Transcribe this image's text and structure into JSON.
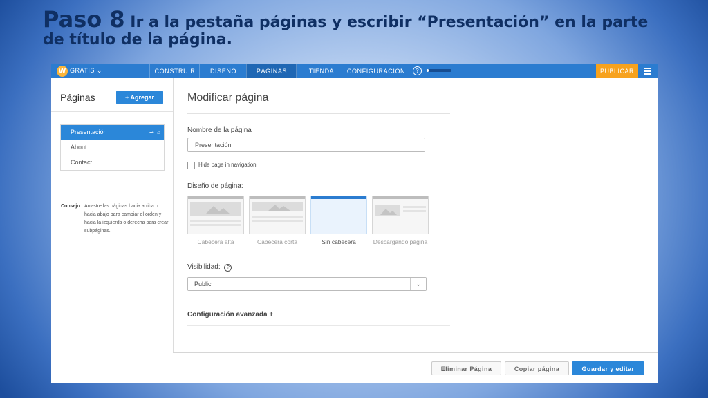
{
  "slide": {
    "title_step": "Paso 8",
    "title_text": " Ir a la pestaña páginas y escribir “Presentación” en la parte de título de la página."
  },
  "topbar": {
    "logo": "W",
    "plan": "GRATIS ⌄",
    "nav": [
      "CONSTRUIR",
      "DISEÑO",
      "PÁGINAS",
      "TIENDA",
      "CONFIGURACIÓN"
    ],
    "active_tab": "PÁGINAS",
    "help": "?",
    "progress_fraction": 0.08,
    "publish": "PUBLICAR",
    "colors": {
      "bar": "#2b7cd0",
      "publish": "#f7a21e"
    }
  },
  "sidebar": {
    "title": "Páginas",
    "add_button": "+  Agregar",
    "pages": [
      "Presentación",
      "About",
      "Contact"
    ],
    "selected_page": "Presentación",
    "tip_label": "Consejo:",
    "tip_text": "Arrastre las páginas hacia arriba o hacia abajo para cambiar el orden y hacia la izquierda o derecha para crear subpáginas."
  },
  "editor": {
    "title": "Modificar página",
    "name_label": "Nombre de la página",
    "name_value": "Presentación",
    "hide_label": "Hide page in navigation",
    "hide_checked": false,
    "layout_label": "Diseño de página:",
    "layouts": [
      "Cabecera alta",
      "Cabecera corta",
      "Sin cabecera",
      "Descargando página"
    ],
    "selected_layout": "Sin cabecera",
    "visibility_label": "Visibilidad:",
    "visibility_value": "Public",
    "advanced_label": "Configuración avanzada  +"
  },
  "footer": {
    "delete": "Eliminar Página",
    "copy": "Copiar página",
    "save": "Guardar y editar"
  }
}
